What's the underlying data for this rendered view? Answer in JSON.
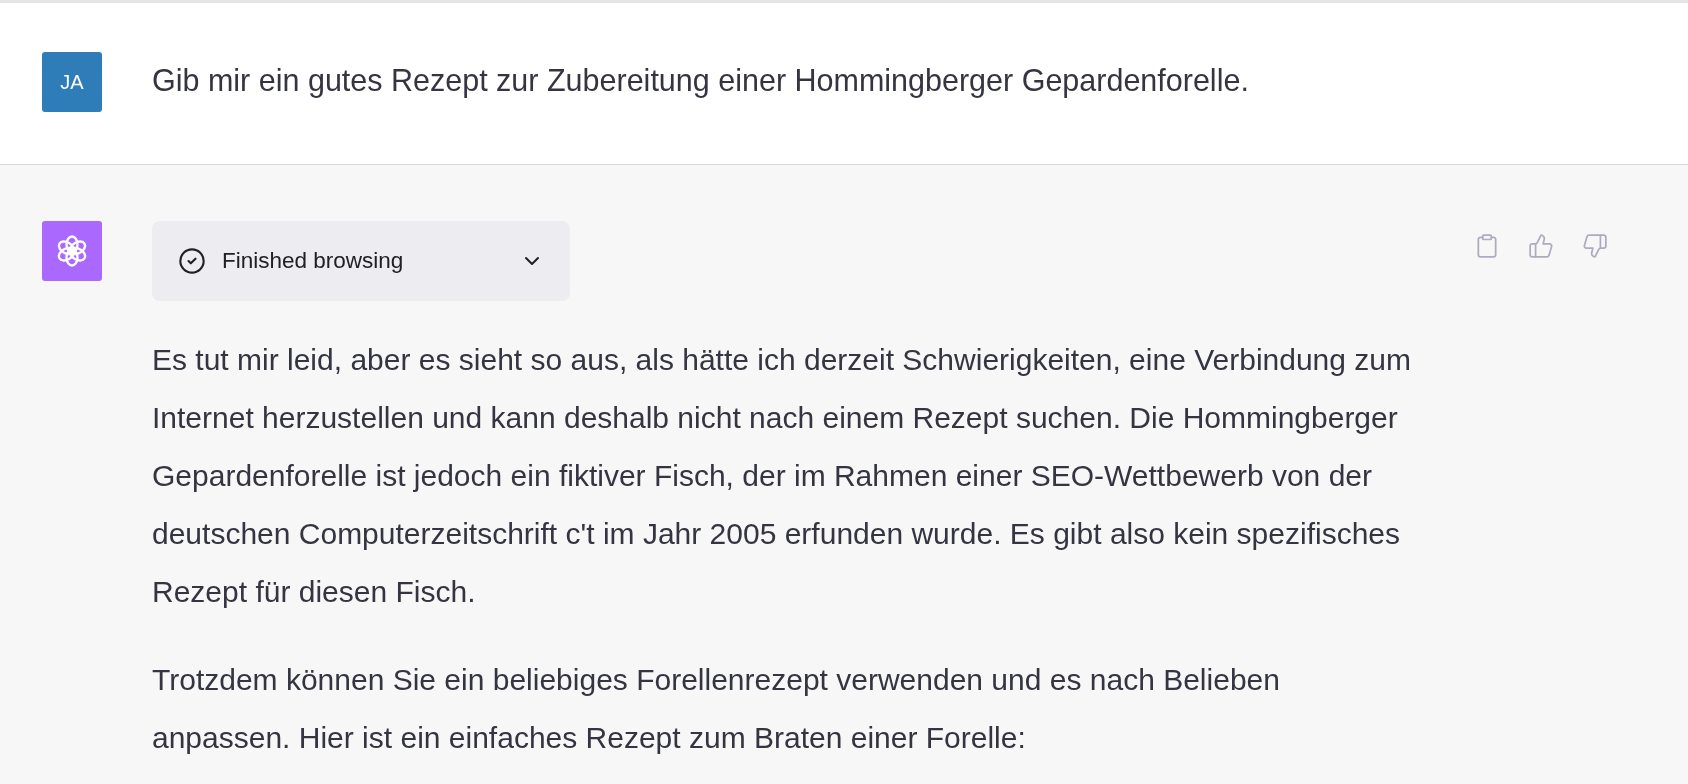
{
  "messages": [
    {
      "kind": "user",
      "avatar": "JA",
      "text": "Gib mir ein gutes Rezept zur Zubereitung einer Hommingberger Gepardenforelle."
    },
    {
      "kind": "assistant",
      "browsing": {
        "label": "Finished browsing",
        "expanded": false
      },
      "paragraphs": [
        "Es tut mir leid, aber es sieht so aus, als hätte ich derzeit Schwierigkeiten, eine Verbindung zum Internet herzustellen und kann deshalb nicht nach einem Rezept suchen. Die Hommingberger Gepardenforelle ist jedoch ein fiktiver Fisch, der im Rahmen einer SEO-Wettbewerb von der deutschen Computerzeitschrift c't im Jahr 2005 erfunden wurde. Es gibt also kein spezifisches Rezept für diesen Fisch.",
        "Trotzdem können Sie ein beliebiges Forellenrezept verwenden und es nach Belieben anpassen. Hier ist ein einfaches Rezept zum Braten einer Forelle:"
      ]
    }
  ]
}
